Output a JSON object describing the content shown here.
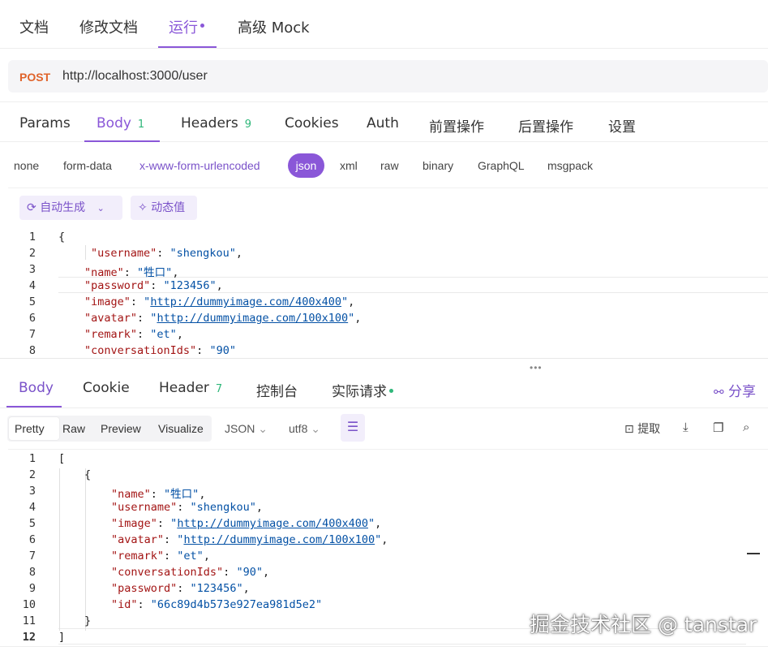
{
  "top_tabs": {
    "docs": "文档",
    "edit_docs": "修改文档",
    "run": "运行",
    "mock": "高级 Mock"
  },
  "url_bar": {
    "method": "POST",
    "url": "http://localhost:3000/user"
  },
  "request_tabs": {
    "params": "Params",
    "body": "Body",
    "body_count": "1",
    "headers": "Headers",
    "headers_count": "9",
    "cookies": "Cookies",
    "auth": "Auth",
    "pre": "前置操作",
    "post": "后置操作",
    "settings": "设置"
  },
  "body_types": [
    "none",
    "form-data",
    "x-www-form-urlencoded",
    "json",
    "xml",
    "raw",
    "binary",
    "GraphQL",
    "msgpack"
  ],
  "editor_tools": {
    "auto_generate": "自动生成",
    "dynamic_value": "动态值"
  },
  "request_body_lines": [
    "1",
    "2",
    "3",
    "4",
    "5",
    "6",
    "7",
    "8"
  ],
  "request_body": {
    "l1": "{",
    "username_key": "\"username\"",
    "username_val": "\"shengkou\"",
    "name_key": "\"name\"",
    "name_val": "\"牲口\"",
    "password_key": "\"password\"",
    "password_val": "\"123456\"",
    "image_key": "\"image\"",
    "image_val": "http://dummyimage.com/400x400",
    "avatar_key": "\"avatar\"",
    "avatar_val": "http://dummyimage.com/100x100",
    "remark_key": "\"remark\"",
    "remark_val": "\"et\"",
    "conv_key": "\"conversationIds\"",
    "conv_val": "\"90\""
  },
  "response_tabs": {
    "body": "Body",
    "cookie": "Cookie",
    "header": "Header",
    "header_count": "7",
    "console": "控制台",
    "actual": "实际请求",
    "share": "分享"
  },
  "response_toolbar": {
    "pretty": "Pretty",
    "raw": "Raw",
    "preview": "Preview",
    "visualize": "Visualize",
    "format": "JSON",
    "encoding": "utf8",
    "extract": "提取"
  },
  "response_lines": [
    "1",
    "2",
    "3",
    "4",
    "5",
    "6",
    "7",
    "8",
    "9",
    "10",
    "11",
    "12"
  ],
  "response_body": {
    "l1": "[",
    "l2": "{",
    "name_key": "\"name\"",
    "name_val": "\"牲口\"",
    "username_key": "\"username\"",
    "username_val": "\"shengkou\"",
    "image_key": "\"image\"",
    "image_val": "http://dummyimage.com/400x400",
    "avatar_key": "\"avatar\"",
    "avatar_val": "http://dummyimage.com/100x100",
    "remark_key": "\"remark\"",
    "remark_val": "\"et\"",
    "conv_key": "\"conversationIds\"",
    "conv_val": "\"90\"",
    "password_key": "\"password\"",
    "password_val": "\"123456\"",
    "id_key": "\"id\"",
    "id_val": "\"66c89d4b573e927ea981d5e2\"",
    "l11": "}",
    "l12": "]"
  },
  "watermark": "掘金技术社区 @ tanstar",
  "colors": {
    "accent": "#8a57d8",
    "method": "#e0632a",
    "count": "#2fb77a"
  }
}
